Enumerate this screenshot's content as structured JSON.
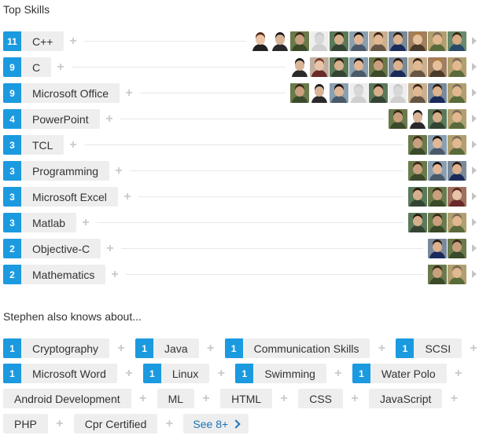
{
  "top_skills_title": "Top Skills",
  "also_knows_title": "Stephen also knows about...",
  "top_skills": [
    {
      "count": "11",
      "name": "C++",
      "avatars": [
        {
          "skin": "#e8c4a8",
          "hair": "#5a2a1a",
          "bg": "#ffffff",
          "shirt": "#222222"
        },
        {
          "skin": "#d9b596",
          "hair": "#1a1a1a",
          "bg": "#ffffff",
          "shirt": "#2a2a2a"
        },
        {
          "skin": "#c9a07e",
          "hair": "#3a2a1a",
          "bg": "#6b7a4a",
          "shirt": "#3a4a2a"
        },
        {
          "skin": "#d8d8d8",
          "hair": "#c8c8c8",
          "bg": "#eeeeee",
          "shirt": "#cfcfcf"
        },
        {
          "skin": "#d6b08c",
          "hair": "#2a1a10",
          "bg": "#5a7a5a",
          "shirt": "#334433"
        },
        {
          "skin": "#e0b898",
          "hair": "#1a1010",
          "bg": "#8aa0b0",
          "shirt": "#4a5a6a"
        },
        {
          "skin": "#e2b893",
          "hair": "#3a2515",
          "bg": "#c8b090",
          "shirt": "#665544"
        },
        {
          "skin": "#dcb28f",
          "hair": "#2a1a10",
          "bg": "#7a8a9a",
          "shirt": "#1a2a5a"
        },
        {
          "skin": "#e6c09c",
          "hair": "#b07a40",
          "bg": "#a08060",
          "shirt": "#4a3a2a"
        },
        {
          "skin": "#e2b890",
          "hair": "#7a6a5a",
          "bg": "#b0a070",
          "shirt": "#5a6a3a"
        },
        {
          "skin": "#d8ac84",
          "hair": "#3a2a1a",
          "bg": "#6a8a6a",
          "shirt": "#2a4a6a"
        }
      ]
    },
    {
      "count": "9",
      "name": "C",
      "avatars": [
        {
          "skin": "#d9b596",
          "hair": "#1a1a1a",
          "bg": "#ffffff",
          "shirt": "#2a2a2a"
        },
        {
          "skin": "#e8c4a8",
          "hair": "#7a3a2a",
          "bg": "#c0b0a0",
          "shirt": "#6a2a2a"
        },
        {
          "skin": "#d6b08c",
          "hair": "#2a1a10",
          "bg": "#5a7a5a",
          "shirt": "#334433"
        },
        {
          "skin": "#e0b898",
          "hair": "#1a1010",
          "bg": "#8aa0b0",
          "shirt": "#4a5a6a"
        },
        {
          "skin": "#c9a07e",
          "hair": "#3a2a1a",
          "bg": "#6b7a4a",
          "shirt": "#3a4a2a"
        },
        {
          "skin": "#dcb28f",
          "hair": "#2a1a10",
          "bg": "#7a8a9a",
          "shirt": "#1a2a5a"
        },
        {
          "skin": "#e2b893",
          "hair": "#3a2515",
          "bg": "#c8b090",
          "shirt": "#665544"
        },
        {
          "skin": "#e6c09c",
          "hair": "#b07a40",
          "bg": "#a08060",
          "shirt": "#4a3a2a"
        },
        {
          "skin": "#e2b890",
          "hair": "#7a6a5a",
          "bg": "#b0a070",
          "shirt": "#5a6a3a"
        }
      ]
    },
    {
      "count": "9",
      "name": "Microsoft Office",
      "avatars": [
        {
          "skin": "#c9a07e",
          "hair": "#3a2a1a",
          "bg": "#6b7a4a",
          "shirt": "#3a4a2a"
        },
        {
          "skin": "#d9b596",
          "hair": "#1a1a1a",
          "bg": "#ffffff",
          "shirt": "#2a2a2a"
        },
        {
          "skin": "#e0b898",
          "hair": "#1a1010",
          "bg": "#8aa0b0",
          "shirt": "#4a5a6a"
        },
        {
          "skin": "#d8d8d8",
          "hair": "#c8c8c8",
          "bg": "#eeeeee",
          "shirt": "#cfcfcf"
        },
        {
          "skin": "#d6b08c",
          "hair": "#2a1a10",
          "bg": "#5a7a5a",
          "shirt": "#334433"
        },
        {
          "skin": "#d8d8d8",
          "hair": "#c8c8c8",
          "bg": "#eeeeee",
          "shirt": "#cfcfcf"
        },
        {
          "skin": "#e2b893",
          "hair": "#3a2515",
          "bg": "#c8b090",
          "shirt": "#665544"
        },
        {
          "skin": "#dcb28f",
          "hair": "#2a1a10",
          "bg": "#7a8a9a",
          "shirt": "#1a2a5a"
        },
        {
          "skin": "#e2b890",
          "hair": "#7a6a5a",
          "bg": "#b0a070",
          "shirt": "#5a6a3a"
        }
      ]
    },
    {
      "count": "4",
      "name": "PowerPoint",
      "avatars": [
        {
          "skin": "#c9a07e",
          "hair": "#3a2a1a",
          "bg": "#6b7a4a",
          "shirt": "#3a4a2a"
        },
        {
          "skin": "#d9b596",
          "hair": "#1a1a1a",
          "bg": "#ffffff",
          "shirt": "#2a2a2a"
        },
        {
          "skin": "#d6b08c",
          "hair": "#2a1a10",
          "bg": "#5a7a5a",
          "shirt": "#334433"
        },
        {
          "skin": "#e2b890",
          "hair": "#7a6a5a",
          "bg": "#b0a070",
          "shirt": "#5a6a3a"
        }
      ]
    },
    {
      "count": "3",
      "name": "TCL",
      "avatars": [
        {
          "skin": "#c9a07e",
          "hair": "#3a2a1a",
          "bg": "#6b7a4a",
          "shirt": "#3a4a2a"
        },
        {
          "skin": "#e0b898",
          "hair": "#1a1010",
          "bg": "#8aa0b0",
          "shirt": "#4a5a6a"
        },
        {
          "skin": "#e2b890",
          "hair": "#7a6a5a",
          "bg": "#b0a070",
          "shirt": "#5a6a3a"
        }
      ]
    },
    {
      "count": "3",
      "name": "Programming",
      "avatars": [
        {
          "skin": "#c9a07e",
          "hair": "#3a2a1a",
          "bg": "#6b7a4a",
          "shirt": "#3a4a2a"
        },
        {
          "skin": "#e0b898",
          "hair": "#1a1010",
          "bg": "#8aa0b0",
          "shirt": "#4a5a6a"
        },
        {
          "skin": "#dcb28f",
          "hair": "#2a1a10",
          "bg": "#7a8a9a",
          "shirt": "#1a2a5a"
        }
      ]
    },
    {
      "count": "3",
      "name": "Microsoft Excel",
      "avatars": [
        {
          "skin": "#d6b08c",
          "hair": "#2a1a10",
          "bg": "#5a7a5a",
          "shirt": "#334433"
        },
        {
          "skin": "#c9a07e",
          "hair": "#3a2a1a",
          "bg": "#6b7a4a",
          "shirt": "#3a4a2a"
        },
        {
          "skin": "#e8c4a8",
          "hair": "#5a2a1a",
          "bg": "#a07060",
          "shirt": "#6a2a2a"
        }
      ]
    },
    {
      "count": "3",
      "name": "Matlab",
      "avatars": [
        {
          "skin": "#d6b08c",
          "hair": "#2a1a10",
          "bg": "#5a7a5a",
          "shirt": "#334433"
        },
        {
          "skin": "#c9a07e",
          "hair": "#3a2a1a",
          "bg": "#6b7a4a",
          "shirt": "#3a4a2a"
        },
        {
          "skin": "#e2b890",
          "hair": "#7a6a5a",
          "bg": "#b0a070",
          "shirt": "#5a6a3a"
        }
      ]
    },
    {
      "count": "2",
      "name": "Objective-C",
      "avatars": [
        {
          "skin": "#dcb28f",
          "hair": "#2a1a10",
          "bg": "#7a8a9a",
          "shirt": "#1a2a5a"
        },
        {
          "skin": "#c9a07e",
          "hair": "#3a2a1a",
          "bg": "#6b7a4a",
          "shirt": "#3a4a2a"
        }
      ]
    },
    {
      "count": "2",
      "name": "Mathematics",
      "avatars": [
        {
          "skin": "#c9a07e",
          "hair": "#3a2a1a",
          "bg": "#6b7a4a",
          "shirt": "#3a4a2a"
        },
        {
          "skin": "#e2b890",
          "hair": "#7a6a5a",
          "bg": "#b0a070",
          "shirt": "#5a6a3a"
        }
      ]
    }
  ],
  "also_knows": [
    [
      {
        "count": "1",
        "name": "Cryptography"
      },
      {
        "count": "1",
        "name": "Java"
      },
      {
        "count": "1",
        "name": "Communication Skills"
      },
      {
        "count": "1",
        "name": "SCSI"
      }
    ],
    [
      {
        "count": "1",
        "name": "Microsoft Word"
      },
      {
        "count": "1",
        "name": "Linux"
      },
      {
        "count": "1",
        "name": "Swimming"
      },
      {
        "count": "1",
        "name": "Water Polo"
      }
    ],
    [
      {
        "count": "",
        "name": "Android Development"
      },
      {
        "count": "",
        "name": "ML"
      },
      {
        "count": "",
        "name": "HTML"
      },
      {
        "count": "",
        "name": "CSS"
      },
      {
        "count": "",
        "name": "JavaScript"
      }
    ],
    [
      {
        "count": "",
        "name": "PHP"
      },
      {
        "count": "",
        "name": "Cpr Certified"
      }
    ]
  ],
  "see_more_label": "See 8+",
  "plus_icon": "plus-icon",
  "arrow_icon": "chevron-right-icon",
  "colors": {
    "count_badge": "#1b9ae0",
    "pill_bg": "#eeeeee",
    "link": "#1b74b8"
  }
}
